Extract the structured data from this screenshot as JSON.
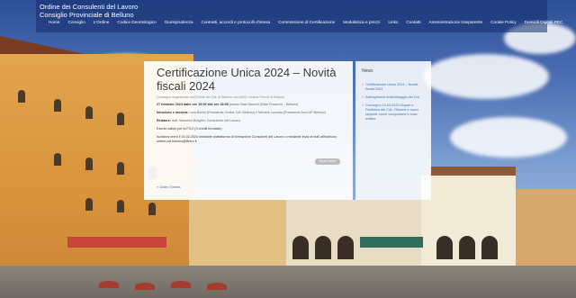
{
  "brand": {
    "line1": "Ordine dei Consulenti del Lavoro",
    "line2": "Consiglio Provinciale di Belluno"
  },
  "nav": [
    {
      "label": "Home",
      "active": false
    },
    {
      "label": "Consiglio",
      "active": false
    },
    {
      "label": "L'Ordine",
      "active": false
    },
    {
      "label": "Codice Deontologico",
      "active": false
    },
    {
      "label": "Giurisprudenza",
      "active": false
    },
    {
      "label": "Contratti, accordi e protocolli d'intesa",
      "active": false
    },
    {
      "label": "Commissione di Certificazione",
      "active": false
    },
    {
      "label": "Modulistica e prezzi",
      "active": false
    },
    {
      "label": "Links",
      "active": false
    },
    {
      "label": "Contatti",
      "active": false
    },
    {
      "label": "Amministrazione trasparente",
      "active": false
    },
    {
      "label": "Cookie Policy",
      "active": false
    },
    {
      "label": "Domicili Digitali PEC",
      "active": false
    }
  ],
  "post": {
    "title": "Certificazione Unica 2024 – Novità fiscali 2024",
    "meta": "Convegno organizzato dall'Ordine dei CdL di Belluno con ANCL Unione Prov.le di Belluno",
    "date_text": "27 febbraio 2024 dalle ore 15:00 alle ore 18:00",
    "date_place": "presso Sala Bianchi (Viale Fusaccio – Belluno)",
    "intro_label": "Introduce e modera:",
    "intro_text": "Lara Bortot (Presidente Ordine CdL Belluno) e Michele Luzzato (Presidente Ancl UP Belluno)",
    "relatore_label": "Relatore:",
    "relatore_text": "dott. Massimo Braghin, Consulente del Lavoro.",
    "credits": "Evento valido per la FCO (3 crediti formativi)",
    "iscrizioni": "Iscrizioni entro il 16.02.2024 mediante piattaforma di formazione Consulenti del Lavoro o mediante invio di mail all'indirizzo ordine.cdl.belluno@libero.it",
    "read_more": "Read more",
    "older_entries": "« Older Entries"
  },
  "sidebar": {
    "title": "News",
    "items": [
      "Certificazione Unica 2024 – Novità fiscali 2024",
      "Adempimenti Antiriciclaggio dei CdL",
      "Convegno 13.03.2023 Dispari e Paritetica dei CdL: Riforme e nuovi rapporti: come comportarsi e cosa evitare"
    ]
  }
}
